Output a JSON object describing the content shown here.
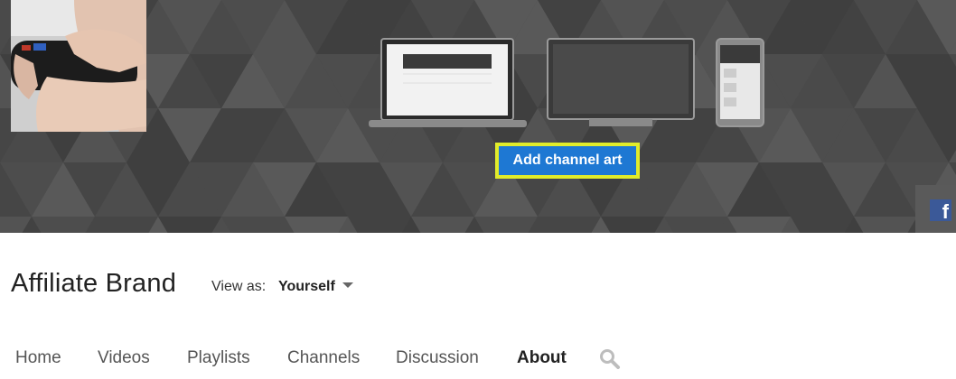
{
  "banner": {
    "add_art_label": "Add channel art",
    "background_color": "#4a4a4a",
    "highlight_color": "#e1ec2a",
    "button_color": "#1e78d3",
    "device_previews": [
      "laptop-preview-icon",
      "tv-preview-icon",
      "phone-preview-icon"
    ],
    "social_icon": "facebook-icon",
    "social_letter": "f"
  },
  "channel": {
    "name": "Affiliate Brand",
    "view_as_label": "View as:",
    "view_as_value": "Yourself"
  },
  "tabs": [
    {
      "label": "Home",
      "active": false
    },
    {
      "label": "Videos",
      "active": false
    },
    {
      "label": "Playlists",
      "active": false
    },
    {
      "label": "Channels",
      "active": false
    },
    {
      "label": "Discussion",
      "active": false
    },
    {
      "label": "About",
      "active": true
    }
  ],
  "search_icon": "search-icon"
}
